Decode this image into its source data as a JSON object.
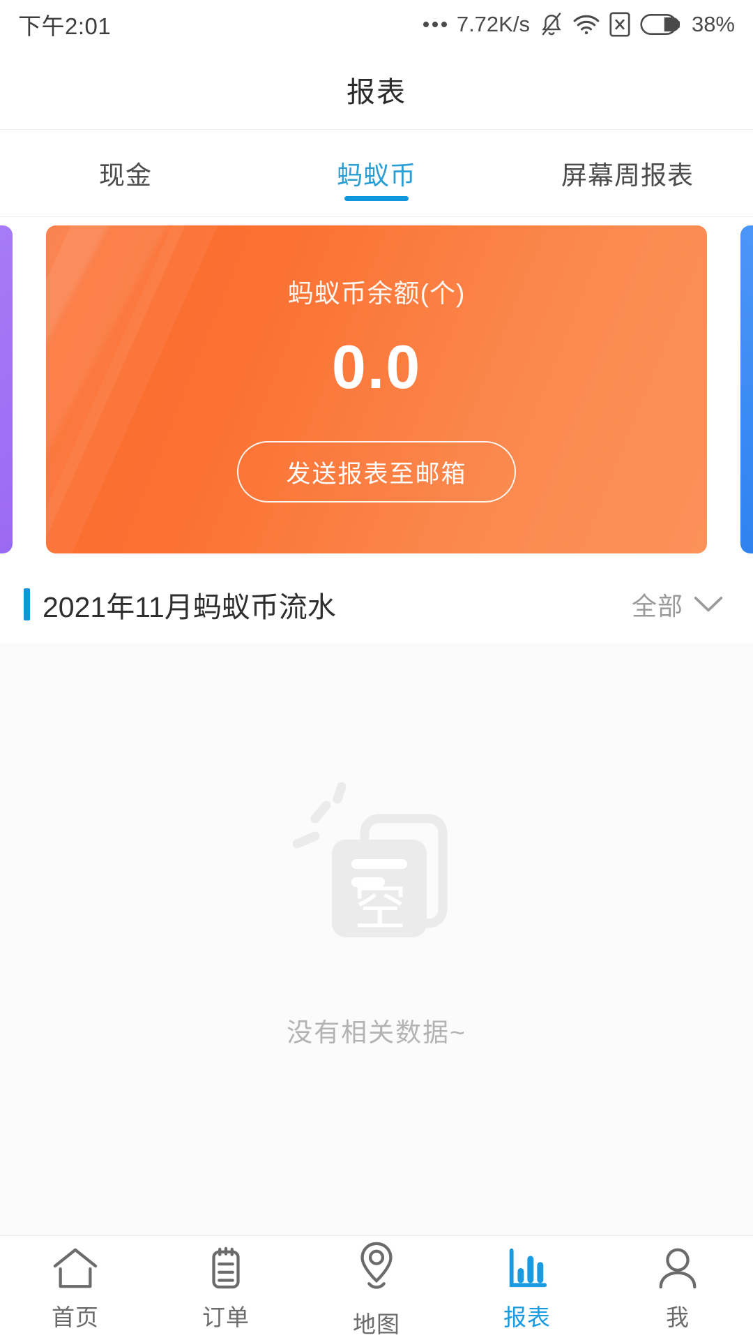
{
  "status_bar": {
    "time": "下午2:01",
    "overflow_icon": "more-dots-icon",
    "network_speed": "7.72K/s",
    "mute_icon": "bell-muted-icon",
    "wifi_icon": "wifi-icon",
    "sim_icon": "sim-card-disabled-icon",
    "battery_icon": "battery-icon",
    "battery_percent": "38%"
  },
  "header": {
    "title": "报表"
  },
  "tabs": {
    "active_index": 1,
    "active_color": "#1296db",
    "items": [
      {
        "label": "现金"
      },
      {
        "label": "蚂蚁币"
      },
      {
        "label": "屏幕周报表"
      }
    ]
  },
  "carousel": {
    "peek_left_color": "#a87bf7",
    "peek_right_color": "#4d97f8",
    "card": {
      "accent_color": "#fb7233",
      "label": "蚂蚁币余额(个)",
      "value": "0.0",
      "button_label": "发送报表至邮箱"
    }
  },
  "section": {
    "accent_color": "#1296db",
    "title": "2021年11月蚂蚁币流水",
    "filter_label": "全部",
    "filter_icon": "chevron-down-icon"
  },
  "empty_state": {
    "icon": "empty-documents-icon",
    "icon_glyph": "空",
    "message": "没有相关数据~"
  },
  "bottom_nav": {
    "active_index": 3,
    "active_color": "#1a9ae0",
    "items": [
      {
        "label": "首页",
        "icon": "home-icon"
      },
      {
        "label": "订单",
        "icon": "clipboard-icon"
      },
      {
        "label": "地图",
        "icon": "map-pin-icon"
      },
      {
        "label": "报表",
        "icon": "bar-chart-icon"
      },
      {
        "label": "我",
        "icon": "person-icon"
      }
    ]
  }
}
